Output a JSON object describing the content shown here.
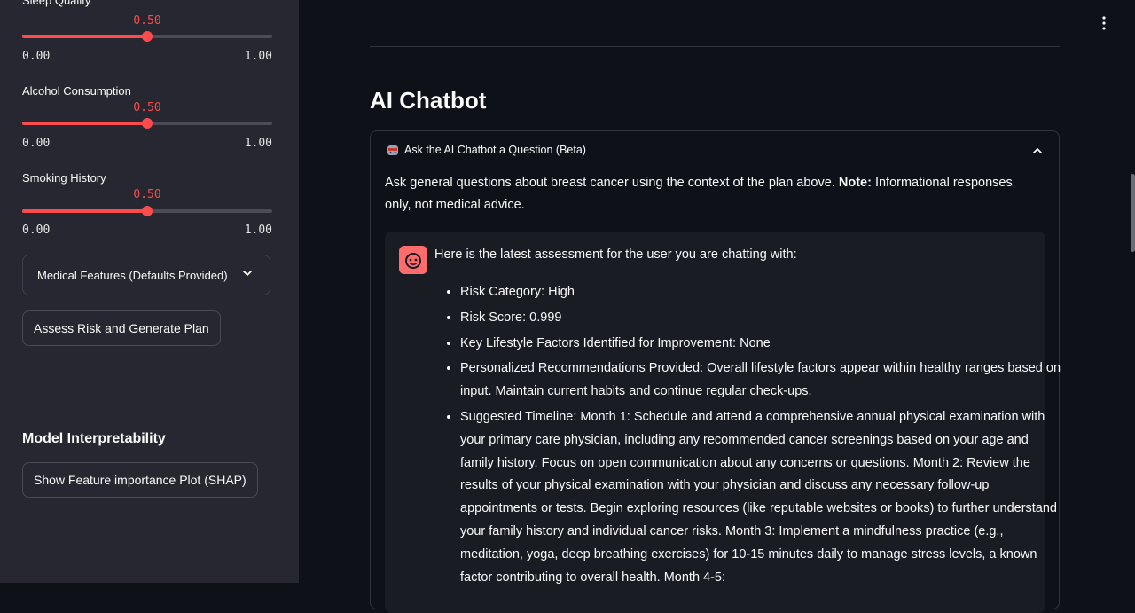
{
  "sidebar": {
    "sliders": [
      {
        "label": "Sleep Quality",
        "value": "0.50",
        "min": "0.00",
        "max": "1.00",
        "fraction": 0.5
      },
      {
        "label": "Alcohol Consumption",
        "value": "0.50",
        "min": "0.00",
        "max": "1.00",
        "fraction": 0.5
      },
      {
        "label": "Smoking History",
        "value": "0.50",
        "min": "0.00",
        "max": "1.00",
        "fraction": 0.5
      }
    ],
    "medical_features_label": "Medical Features (Defaults Provided)",
    "assess_button_label": "Assess Risk and Generate Plan",
    "interpretability_title": "Model Interpretability",
    "shap_button_label": "Show Feature importance Plot (SHAP)"
  },
  "main": {
    "heading": "AI Chatbot",
    "expander_title": "Ask the AI Chatbot a Question (Beta)",
    "intro_prefix": "Ask general questions about breast cancer using the context of the plan above. ",
    "intro_note": "Note:",
    "intro_suffix": " Informational responses only, not medical advice.",
    "message": {
      "intro": "Here is the latest assessment for the user you are chatting with:",
      "items": [
        "Risk Category: High",
        "Risk Score: 0.999",
        "Key Lifestyle Factors Identified for Improvement: None",
        "Personalized Recommendations Provided: Overall lifestyle factors appear within healthy ranges based on input. Maintain current habits and continue regular check-ups.",
        "Suggested Timeline: Month 1: Schedule and attend a comprehensive annual physical examination with your primary care physician, including any recommended cancer screenings based on your age and family history. Focus on open communication about any concerns or questions. Month 2: Review the results of your physical examination with your physician and discuss any necessary follow-up appointments or tests. Begin exploring resources (like reputable websites or books) to further understand your family history and individual cancer risks. Month 3: Implement a mindfulness practice (e.g., meditation, yoga, deep breathing exercises) for 10-15 minutes daily to manage stress levels, a known factor contributing to overall health. Month 4-5:"
      ]
    }
  },
  "colors": {
    "accent": "#ff4b4b",
    "sidebar_bg": "#262730",
    "main_bg": "#0e1117"
  },
  "icons": {
    "menu": "vertical-dots-icon",
    "expander": "chevron-up-icon",
    "avatar": "bot-face-icon"
  }
}
